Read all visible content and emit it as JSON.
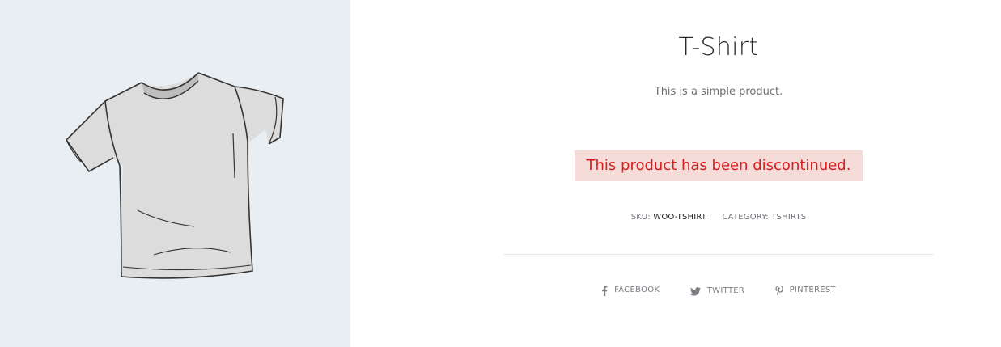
{
  "product": {
    "title": "T-Shirt",
    "short_description": "This is a simple product.",
    "notice": "This product has been discontinued.",
    "notice_colors": {
      "text": "#d81e1e",
      "background": "#f5dcd9"
    },
    "image_alt": "t-shirt-illustration"
  },
  "meta": {
    "sku_label": "SKU:",
    "sku_value": "WOO-TSHIRT",
    "category_label": "CATEGORY:",
    "category_value": "TSHIRTS"
  },
  "share": {
    "items": [
      {
        "label": "FACEBOOK",
        "icon": "facebook-icon"
      },
      {
        "label": "TWITTER",
        "icon": "twitter-icon"
      },
      {
        "label": "PINTEREST",
        "icon": "pinterest-icon"
      }
    ]
  }
}
